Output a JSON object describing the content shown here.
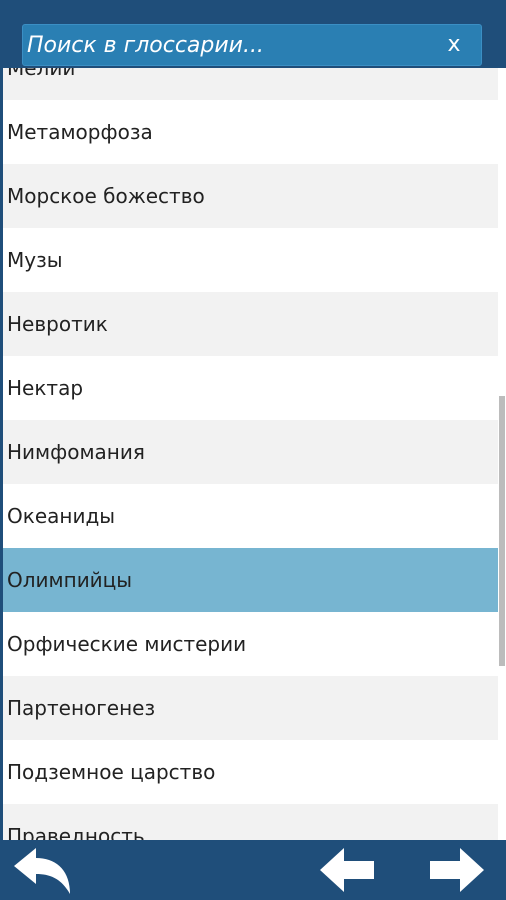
{
  "search": {
    "placeholder": "Поиск в глоссарии...",
    "value": "",
    "clear_label": "x"
  },
  "list": {
    "items": [
      "Мелии",
      "Метаморфоза",
      "Морское божество",
      "Музы",
      "Невротик",
      "Нектар",
      "Нимфомания",
      "Океаниды",
      "Олимпийцы",
      "Орфические мистерии",
      "Партеногенез",
      "Подземное царство",
      "Праведность"
    ],
    "selected_index": 8
  },
  "nav": {
    "back_icon": "back-arrow-icon",
    "prev_icon": "left-arrow-icon",
    "next_icon": "right-arrow-icon"
  },
  "colors": {
    "bar": "#1f4e7a",
    "search_bg": "#2a7fb3",
    "selected": "#77b5d1",
    "row_alt": "#f2f2f2"
  }
}
